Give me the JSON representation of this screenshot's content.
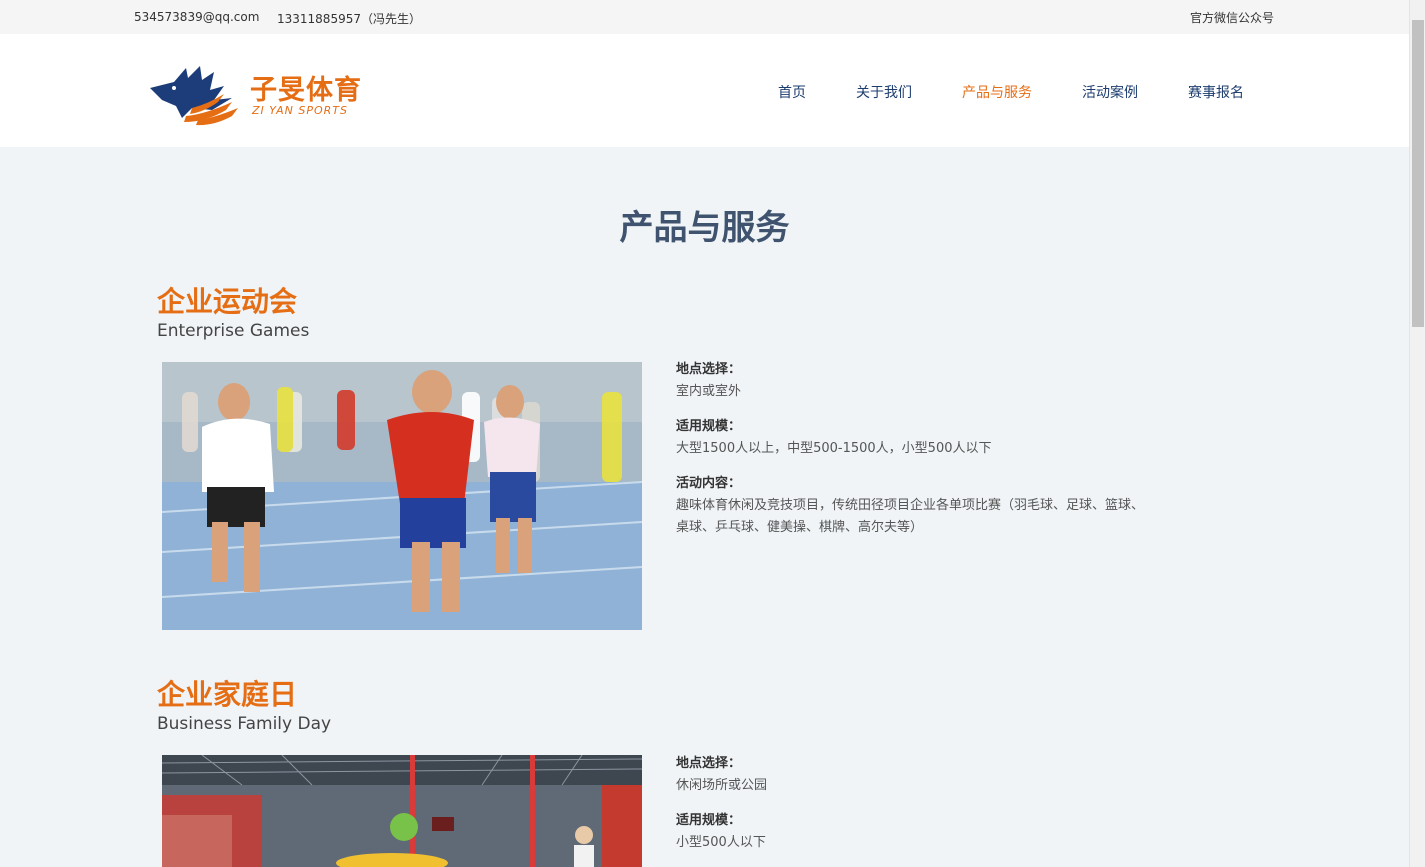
{
  "topbar": {
    "email": "534573839@qq.com",
    "phone": "13311885957（冯先生）",
    "wechat": "官方微信公众号"
  },
  "logo": {
    "name_cn": "子旻体育",
    "name_en": "ZI YAN SPORTS"
  },
  "nav": {
    "items": [
      {
        "label": "首页",
        "active": false
      },
      {
        "label": "关于我们",
        "active": false
      },
      {
        "label": "产品与服务",
        "active": true
      },
      {
        "label": "活动案例",
        "active": false
      },
      {
        "label": "赛事报名",
        "active": false
      }
    ]
  },
  "page_title": "产品与服务",
  "sections": [
    {
      "title": "企业运动会",
      "subtitle": "Enterprise Games",
      "photo_icon": "sprinters-photo",
      "details": [
        {
          "label": "地点选择：",
          "value": "室内或室外"
        },
        {
          "label": "适用规模：",
          "value": "大型1500人以上，中型500-1500人，小型500人以下"
        },
        {
          "label": "活动内容：",
          "value": "趣味体育休闲及竞技项目，传统田径项目企业各单项比赛（羽毛球、足球、篮球、桌球、乒乓球、健美操、棋牌、高尔夫等）"
        }
      ]
    },
    {
      "title": "企业家庭日",
      "subtitle": "Business Family Day",
      "photo_icon": "indoor-arena-photo",
      "details": [
        {
          "label": "地点选择：",
          "value": "休闲场所或公园"
        },
        {
          "label": "适用规模：",
          "value": "小型500人以下"
        }
      ]
    }
  ],
  "colors": {
    "accent": "#e56e15",
    "nav_text": "#1c3d6e",
    "title_text": "#3f536e",
    "page_bg": "#f0f4f7"
  }
}
